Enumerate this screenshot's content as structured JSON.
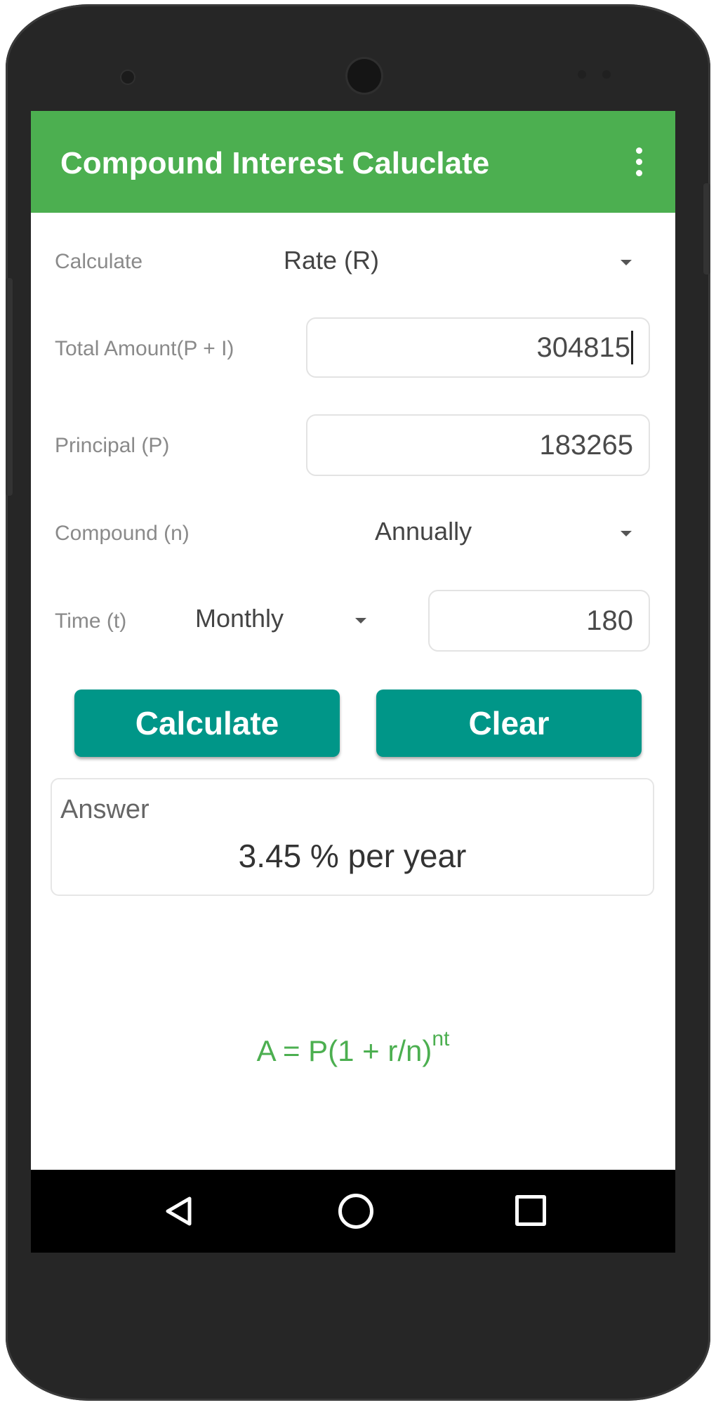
{
  "app": {
    "title": "Compound Interest Caluclate"
  },
  "form": {
    "calculate": {
      "label": "Calculate",
      "value": "Rate (R)"
    },
    "total_amount": {
      "label": "Total Amount(P + I)",
      "value": "304815"
    },
    "principal": {
      "label": "Principal (P)",
      "value": "183265"
    },
    "compound": {
      "label": "Compound (n)",
      "value": "Annually"
    },
    "time": {
      "label": "Time (t)",
      "unit": "Monthly",
      "value": "180"
    }
  },
  "buttons": {
    "calculate": "Calculate",
    "clear": "Clear"
  },
  "answer": {
    "label": "Answer",
    "value": "3.45 % per year"
  },
  "formula": {
    "base": "A = P(1 + r/n)",
    "exponent": "nt"
  },
  "colors": {
    "appbar": "#4caf50",
    "button": "#009688",
    "formula": "#4caf50"
  },
  "icons": {
    "overflow": "overflow-menu-icon",
    "back": "back-icon",
    "home": "home-icon",
    "recent": "recent-apps-icon"
  }
}
